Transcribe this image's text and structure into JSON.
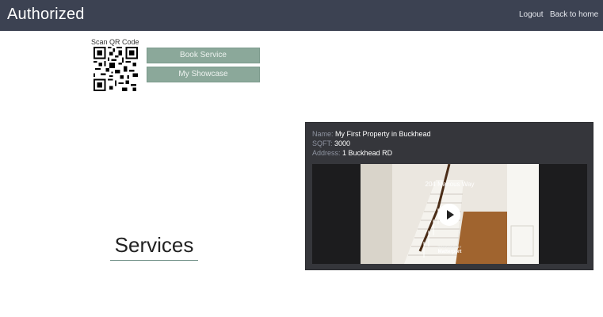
{
  "nav": {
    "brand": "Authorized",
    "logout": "Logout",
    "back_home": "Back to home"
  },
  "qr": {
    "label": "Scan QR Code"
  },
  "buttons": {
    "book_service": "Book Service",
    "my_showcase": "My Showcase"
  },
  "services": {
    "title": "Services"
  },
  "property": {
    "name_label": "Name:",
    "name_value": "My First Property in Buckhead",
    "sqft_label": "SQFT:",
    "sqft_value": "3000",
    "address_label": "Address:",
    "address_value": "1 Buckhead RD"
  },
  "viewer": {
    "scene_title": "204 Manous Way",
    "powered_by": "POWERED BY",
    "provider": "Matterport"
  },
  "colors": {
    "navbar": "#3c4252",
    "button": "#8ba89a",
    "card": "#35363b"
  }
}
